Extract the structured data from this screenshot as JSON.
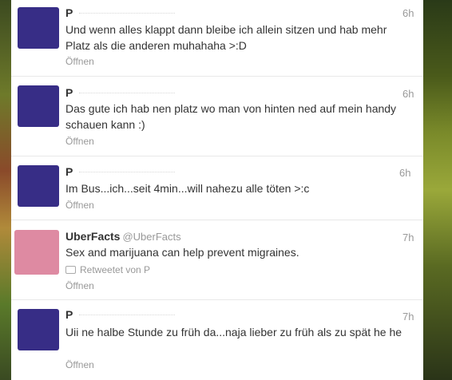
{
  "tweets": [
    {
      "name": "P",
      "handle": "",
      "time": "6h",
      "text": "Und wenn alles klappt dann bleibe ich allein sitzen und hab mehr Platz als die anderen muhahaha >:D",
      "open_label": "Öffnen",
      "avatar_color": "#372d86"
    },
    {
      "name": "P",
      "handle": "",
      "time": "6h",
      "text": "Das gute ich hab nen platz wo man von hinten ned auf mein handy schauen kann :)",
      "open_label": "Öffnen",
      "avatar_color": "#372d86"
    },
    {
      "name": "P",
      "handle": "",
      "time": "6h",
      "text": "Im Bus...ich...seit 4min...will nahezu alle töten >:c",
      "open_label": "Öffnen",
      "avatar_color": "#372d86"
    },
    {
      "name": "UberFacts",
      "handle": "@UberFacts",
      "time": "7h",
      "text": "Sex and marijuana can help prevent migraines.",
      "retweet_label": "Retweetet von P",
      "open_label": "Öffnen",
      "avatar_color": "#de8aa2"
    },
    {
      "name": "P",
      "handle": "",
      "time": "7h",
      "text": "Uii ne halbe Stunde zu früh da...naja lieber zu früh als zu spät he he",
      "open_label": "Öffnen",
      "avatar_color": "#372d86"
    }
  ]
}
